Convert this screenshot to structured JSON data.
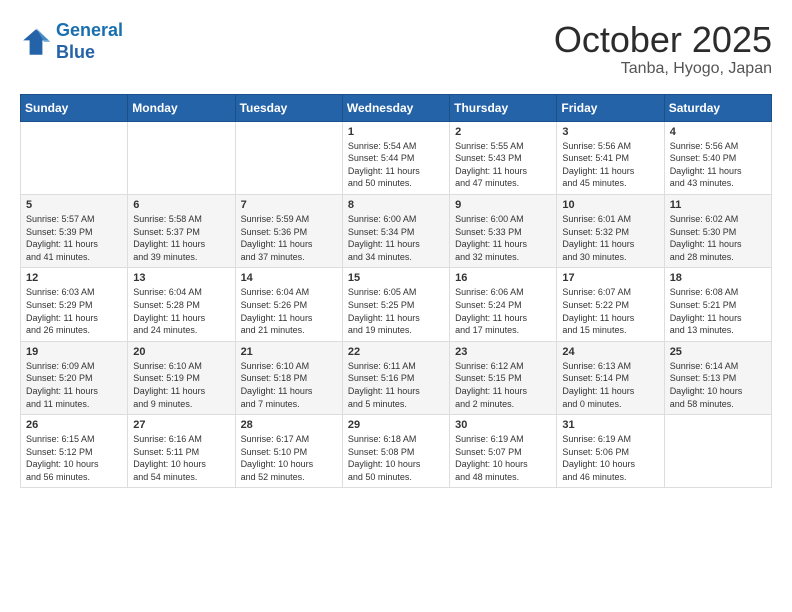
{
  "header": {
    "logo_line1": "General",
    "logo_line2": "Blue",
    "month": "October 2025",
    "location": "Tanba, Hyogo, Japan"
  },
  "weekdays": [
    "Sunday",
    "Monday",
    "Tuesday",
    "Wednesday",
    "Thursday",
    "Friday",
    "Saturday"
  ],
  "weeks": [
    [
      {
        "day": "",
        "info": ""
      },
      {
        "day": "",
        "info": ""
      },
      {
        "day": "",
        "info": ""
      },
      {
        "day": "1",
        "info": "Sunrise: 5:54 AM\nSunset: 5:44 PM\nDaylight: 11 hours\nand 50 minutes."
      },
      {
        "day": "2",
        "info": "Sunrise: 5:55 AM\nSunset: 5:43 PM\nDaylight: 11 hours\nand 47 minutes."
      },
      {
        "day": "3",
        "info": "Sunrise: 5:56 AM\nSunset: 5:41 PM\nDaylight: 11 hours\nand 45 minutes."
      },
      {
        "day": "4",
        "info": "Sunrise: 5:56 AM\nSunset: 5:40 PM\nDaylight: 11 hours\nand 43 minutes."
      }
    ],
    [
      {
        "day": "5",
        "info": "Sunrise: 5:57 AM\nSunset: 5:39 PM\nDaylight: 11 hours\nand 41 minutes."
      },
      {
        "day": "6",
        "info": "Sunrise: 5:58 AM\nSunset: 5:37 PM\nDaylight: 11 hours\nand 39 minutes."
      },
      {
        "day": "7",
        "info": "Sunrise: 5:59 AM\nSunset: 5:36 PM\nDaylight: 11 hours\nand 37 minutes."
      },
      {
        "day": "8",
        "info": "Sunrise: 6:00 AM\nSunset: 5:34 PM\nDaylight: 11 hours\nand 34 minutes."
      },
      {
        "day": "9",
        "info": "Sunrise: 6:00 AM\nSunset: 5:33 PM\nDaylight: 11 hours\nand 32 minutes."
      },
      {
        "day": "10",
        "info": "Sunrise: 6:01 AM\nSunset: 5:32 PM\nDaylight: 11 hours\nand 30 minutes."
      },
      {
        "day": "11",
        "info": "Sunrise: 6:02 AM\nSunset: 5:30 PM\nDaylight: 11 hours\nand 28 minutes."
      }
    ],
    [
      {
        "day": "12",
        "info": "Sunrise: 6:03 AM\nSunset: 5:29 PM\nDaylight: 11 hours\nand 26 minutes."
      },
      {
        "day": "13",
        "info": "Sunrise: 6:04 AM\nSunset: 5:28 PM\nDaylight: 11 hours\nand 24 minutes."
      },
      {
        "day": "14",
        "info": "Sunrise: 6:04 AM\nSunset: 5:26 PM\nDaylight: 11 hours\nand 21 minutes."
      },
      {
        "day": "15",
        "info": "Sunrise: 6:05 AM\nSunset: 5:25 PM\nDaylight: 11 hours\nand 19 minutes."
      },
      {
        "day": "16",
        "info": "Sunrise: 6:06 AM\nSunset: 5:24 PM\nDaylight: 11 hours\nand 17 minutes."
      },
      {
        "day": "17",
        "info": "Sunrise: 6:07 AM\nSunset: 5:22 PM\nDaylight: 11 hours\nand 15 minutes."
      },
      {
        "day": "18",
        "info": "Sunrise: 6:08 AM\nSunset: 5:21 PM\nDaylight: 11 hours\nand 13 minutes."
      }
    ],
    [
      {
        "day": "19",
        "info": "Sunrise: 6:09 AM\nSunset: 5:20 PM\nDaylight: 11 hours\nand 11 minutes."
      },
      {
        "day": "20",
        "info": "Sunrise: 6:10 AM\nSunset: 5:19 PM\nDaylight: 11 hours\nand 9 minutes."
      },
      {
        "day": "21",
        "info": "Sunrise: 6:10 AM\nSunset: 5:18 PM\nDaylight: 11 hours\nand 7 minutes."
      },
      {
        "day": "22",
        "info": "Sunrise: 6:11 AM\nSunset: 5:16 PM\nDaylight: 11 hours\nand 5 minutes."
      },
      {
        "day": "23",
        "info": "Sunrise: 6:12 AM\nSunset: 5:15 PM\nDaylight: 11 hours\nand 2 minutes."
      },
      {
        "day": "24",
        "info": "Sunrise: 6:13 AM\nSunset: 5:14 PM\nDaylight: 11 hours\nand 0 minutes."
      },
      {
        "day": "25",
        "info": "Sunrise: 6:14 AM\nSunset: 5:13 PM\nDaylight: 10 hours\nand 58 minutes."
      }
    ],
    [
      {
        "day": "26",
        "info": "Sunrise: 6:15 AM\nSunset: 5:12 PM\nDaylight: 10 hours\nand 56 minutes."
      },
      {
        "day": "27",
        "info": "Sunrise: 6:16 AM\nSunset: 5:11 PM\nDaylight: 10 hours\nand 54 minutes."
      },
      {
        "day": "28",
        "info": "Sunrise: 6:17 AM\nSunset: 5:10 PM\nDaylight: 10 hours\nand 52 minutes."
      },
      {
        "day": "29",
        "info": "Sunrise: 6:18 AM\nSunset: 5:08 PM\nDaylight: 10 hours\nand 50 minutes."
      },
      {
        "day": "30",
        "info": "Sunrise: 6:19 AM\nSunset: 5:07 PM\nDaylight: 10 hours\nand 48 minutes."
      },
      {
        "day": "31",
        "info": "Sunrise: 6:19 AM\nSunset: 5:06 PM\nDaylight: 10 hours\nand 46 minutes."
      },
      {
        "day": "",
        "info": ""
      }
    ]
  ]
}
